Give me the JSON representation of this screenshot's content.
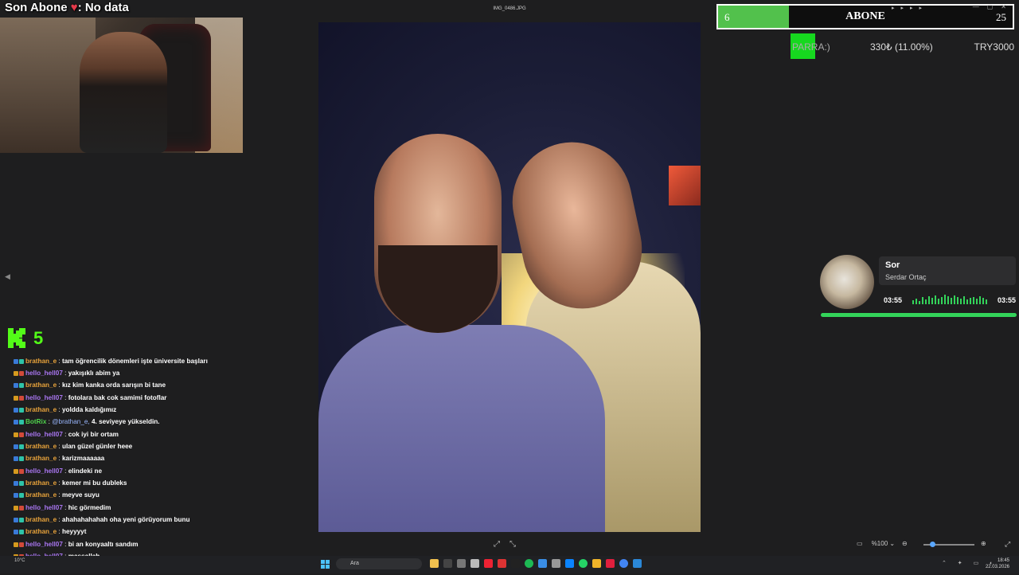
{
  "overlay": {
    "last_sub_prefix": "Son Abone",
    "last_sub_heart": "♥",
    "last_sub_value": ": No data",
    "viewer_count": "5"
  },
  "viewer": {
    "file_name": "IMG_0486.JPG",
    "zoom": "%100",
    "controls": [
      "⤢",
      "⤡"
    ]
  },
  "abone_goal": {
    "current": "6",
    "label": "ABONE",
    "goal": "25",
    "progress_fraction": 0.24,
    "fill_color": "#52c14c"
  },
  "donation_goal": {
    "label": "PARRA:)",
    "amount": "330₺ (11.00%)",
    "goal": "TRY3000",
    "progress_fraction": 0.11,
    "fill_color": "#16d81f"
  },
  "music": {
    "song": "Sor",
    "artist": "Serdar Ortaç",
    "elapsed": "03:55",
    "total": "03:55",
    "progress_fraction": 1.0,
    "accent": "#33d45a"
  },
  "chat": {
    "messages": [
      {
        "user": "brathan_e",
        "text": "tam öğrencilik dönemleri işte üniversite başları",
        "type": "brathan"
      },
      {
        "user": "hello_hell07",
        "text": "yakışıklı abim ya",
        "type": "hello"
      },
      {
        "user": "brathan_e",
        "text": "kız kim kanka orda sarışın bi tane",
        "type": "brathan"
      },
      {
        "user": "hello_hell07",
        "text": "fotolara bak cok samimi fotoflar",
        "type": "hello"
      },
      {
        "user": "brathan_e",
        "text": "yoldda kaldığımız",
        "type": "brathan"
      },
      {
        "user": "BotRix",
        "text": "4. seviyeye yükseldin.",
        "mention": "@brathan_e,",
        "type": "botrix"
      },
      {
        "user": "hello_hell07",
        "text": "cok iyi bir ortam",
        "type": "hello"
      },
      {
        "user": "brathan_e",
        "text": "ulan güzel günler heee",
        "type": "brathan"
      },
      {
        "user": "brathan_e",
        "text": "karizmaaaaaa",
        "type": "brathan"
      },
      {
        "user": "hello_hell07",
        "text": "elindeki ne",
        "type": "hello"
      },
      {
        "user": "brathan_e",
        "text": "kemer mi bu dubleks",
        "type": "brathan"
      },
      {
        "user": "brathan_e",
        "text": "meyve suyu",
        "type": "brathan"
      },
      {
        "user": "hello_hell07",
        "text": "hic görmedim",
        "type": "hello"
      },
      {
        "user": "brathan_e",
        "text": "ahahahahahah oha yeni görüyorum bunu",
        "type": "brathan"
      },
      {
        "user": "brathan_e",
        "text": "heyyyyt",
        "type": "brathan"
      },
      {
        "user": "hello_hell07",
        "text": "bi an konyaaltı sandım",
        "type": "hello"
      },
      {
        "user": "hello_hell07",
        "text": "maşşallah",
        "type": "hello"
      },
      {
        "user": "hello_hell07",
        "text": "",
        "type": "hello"
      }
    ]
  },
  "taskbar": {
    "search_placeholder": "Ara",
    "weather": "10°C",
    "time": "18:45",
    "date": "22.03.2026",
    "icons": [
      "file-explorer-icon",
      "taskview-icon",
      "widgets-icon",
      "arrow-icon",
      "opera-icon",
      "chrome-alt-icon",
      "tiktok-icon",
      "spotify-icon",
      "mail-icon",
      "settings-icon",
      "store-icon",
      "whatsapp-icon",
      "folder-icon",
      "opera-gx-icon",
      "chrome-icon",
      "photos-icon"
    ]
  }
}
